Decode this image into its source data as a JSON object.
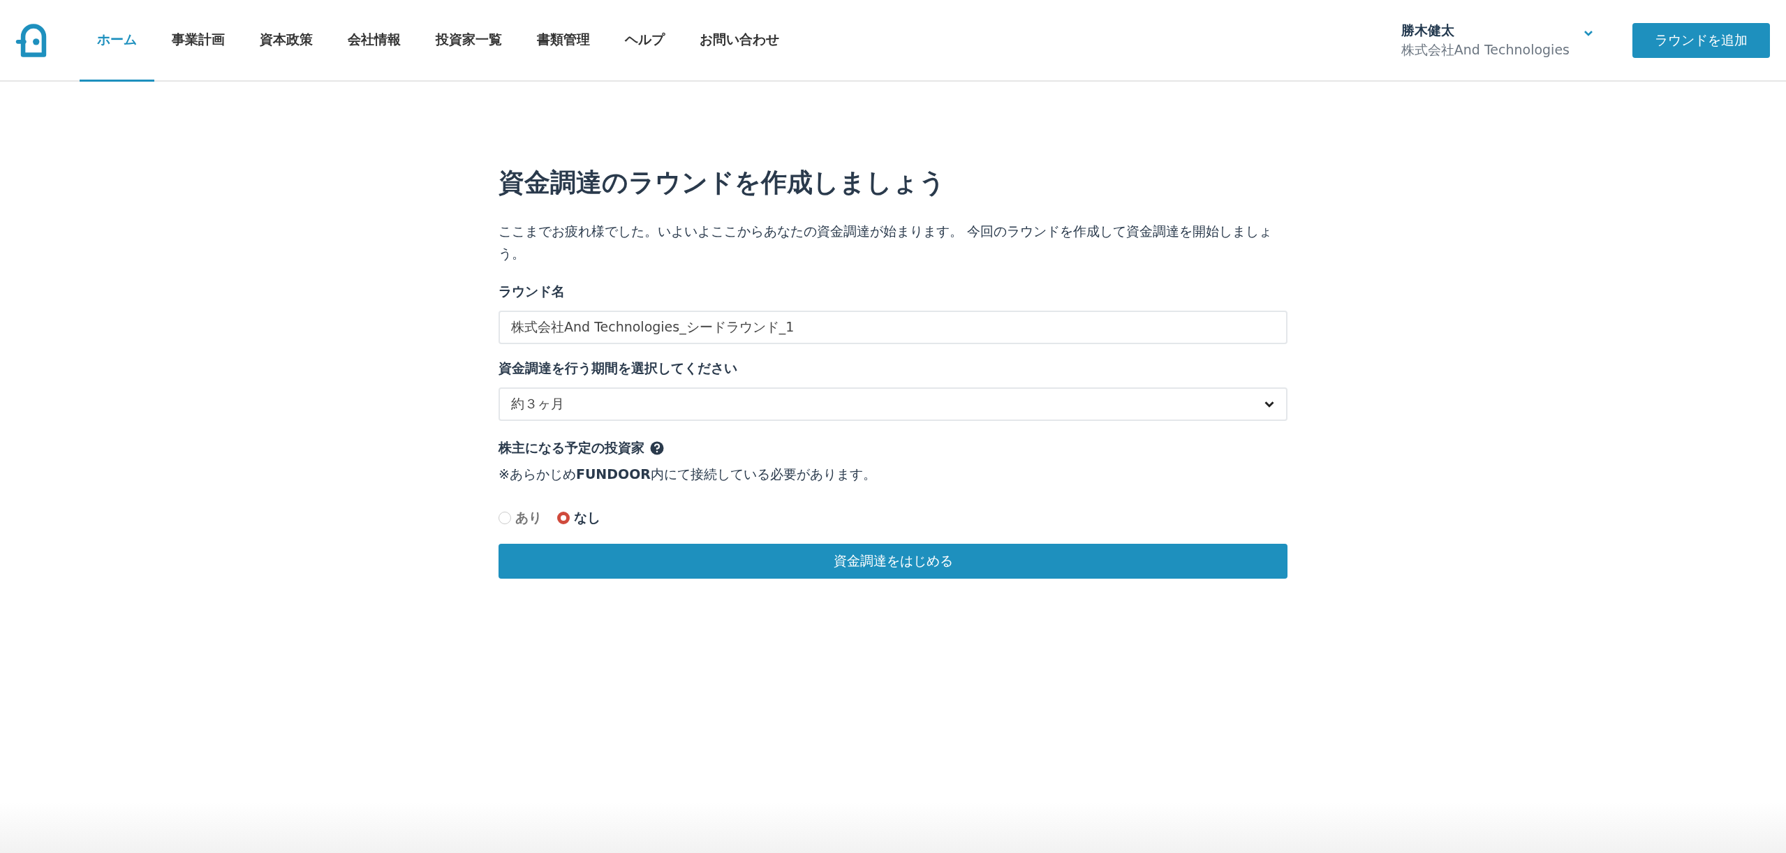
{
  "header": {
    "nav": [
      {
        "label": "ホーム",
        "selected": true
      },
      {
        "label": "事業計画",
        "selected": false
      },
      {
        "label": "資本政策",
        "selected": false
      },
      {
        "label": "会社情報",
        "selected": false
      },
      {
        "label": "投資家一覧",
        "selected": false
      },
      {
        "label": "書類管理",
        "selected": false
      },
      {
        "label": "ヘルプ",
        "selected": false
      },
      {
        "label": "お問い合わせ",
        "selected": false
      }
    ],
    "user": {
      "name": "勝木健太",
      "company": "株式会社And Technologies"
    },
    "add_button": "ラウンドを追加"
  },
  "form": {
    "title": "資金調達のラウンドを作成しましょう",
    "intro": "ここまでお疲れ様でした。いよいよここからあなたの資金調達が始まります。 今回のラウンドを作成して資金調達を開始しましょう。",
    "round_name": {
      "label": "ラウンド名",
      "value": "株式会社And Technologies_シードラウンド_1"
    },
    "period": {
      "label": "資金調達を行う期間を選択してください",
      "value": "約３ヶ月"
    },
    "investors": {
      "label": "株主になる予定の投資家",
      "note": "※あらかじめ**FUNDOOR**内にて接続している必要があります。",
      "options": [
        {
          "label": "あり",
          "selected": false
        },
        {
          "label": "なし",
          "selected": true
        }
      ]
    },
    "submit": "資金調達をはじめる"
  }
}
